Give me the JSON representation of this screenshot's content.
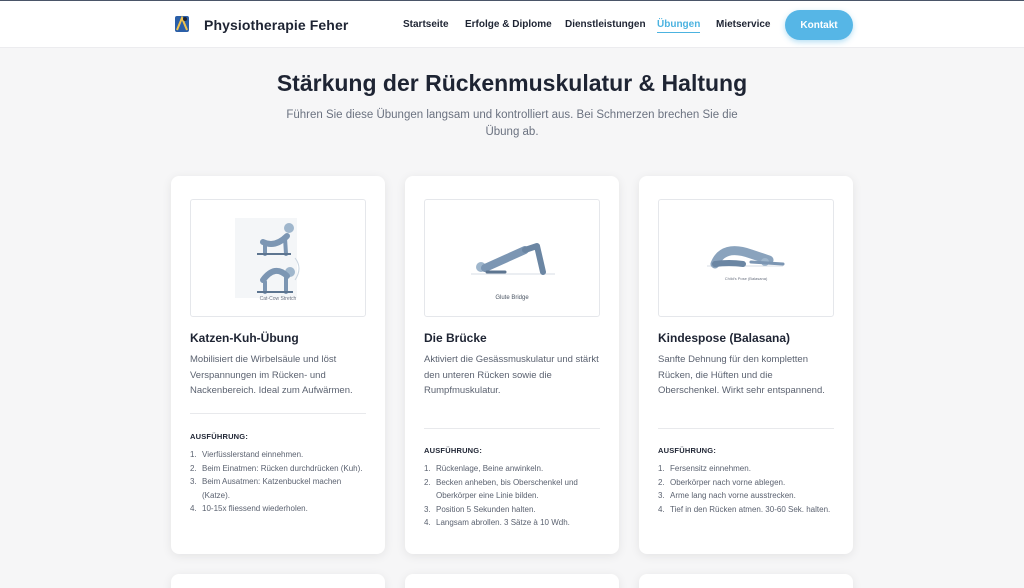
{
  "header": {
    "brand": "Physiotherapie Feher",
    "nav": [
      "Startseite",
      "Erfolge & Diplome",
      "Dienstleistungen",
      "Übungen",
      "Mietservice"
    ],
    "active_nav": "Übungen",
    "contact_label": "Kontakt"
  },
  "hero": {
    "title": "Stärkung der Rückenmuskulatur & Haltung",
    "subtitle": "Führen Sie diese Übungen langsam und kontrolliert aus. Bei Schmerzen brechen Sie die Übung ab."
  },
  "cards": [
    {
      "image_caption": "Cat-Cow Stretch",
      "title": "Katzen-Kuh-Übung",
      "description": "Mobilisiert die Wirbelsäule und löst Verspannungen im Rücken- und Nackenbereich. Ideal zum Aufwärmen.",
      "steps_heading": "AUSFÜHRUNG:",
      "steps": [
        "Vierfüsslerstand einnehmen.",
        "Beim Einatmen: Rücken durchdrücken (Kuh).",
        "Beim Ausatmen: Katzenbuckel machen (Katze).",
        "10-15x fliessend wiederholen."
      ]
    },
    {
      "image_caption": "Glute Bridge",
      "title": "Die Brücke",
      "description": "Aktiviert die Gesässmuskulatur und stärkt den unteren Rücken sowie die Rumpfmuskulatur.",
      "steps_heading": "AUSFÜHRUNG:",
      "steps": [
        "Rückenlage, Beine anwinkeln.",
        "Becken anheben, bis Oberschenkel und Oberkörper eine Linie bilden.",
        "Position 5 Sekunden halten.",
        "Langsam abrollen. 3 Sätze à 10 Wdh."
      ]
    },
    {
      "image_caption": "Child's Pose (Balasana)",
      "title": "Kindespose (Balasana)",
      "description": "Sanfte Dehnung für den kompletten Rücken, die Hüften und die Oberschenkel. Wirkt sehr entspannend.",
      "steps_heading": "AUSFÜHRUNG:",
      "steps": [
        "Fersensitz einnehmen.",
        "Oberkörper nach vorne ablegen.",
        "Arme lang nach vorne ausstrecken.",
        "Tief in den Rücken atmen. 30-60 Sek. halten."
      ]
    }
  ]
}
